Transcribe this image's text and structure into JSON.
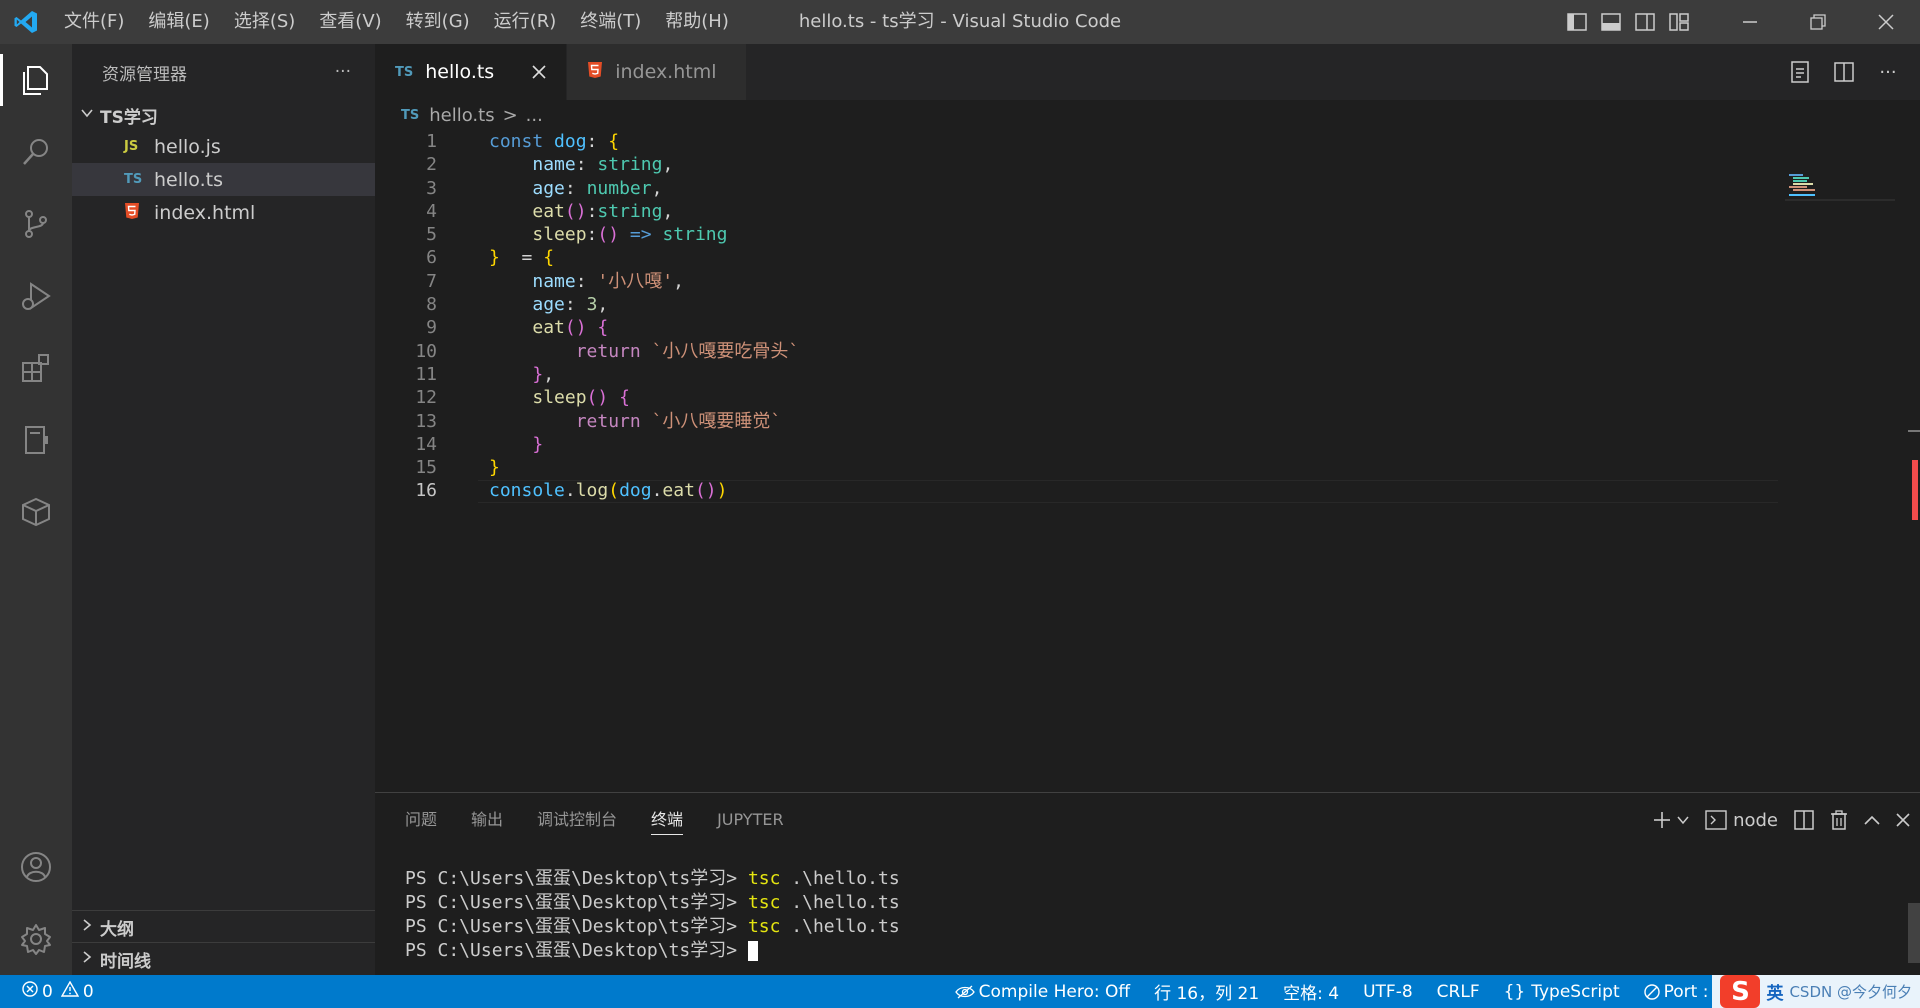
{
  "titlebar": {
    "menu": [
      "文件(F)",
      "编辑(E)",
      "选择(S)",
      "查看(V)",
      "转到(G)",
      "运行(R)",
      "终端(T)",
      "帮助(H)"
    ],
    "window_title": "hello.ts - ts学习 - Visual Studio Code"
  },
  "sidebar": {
    "header": "资源管理器",
    "more": "···",
    "folder": "TS学习",
    "files": [
      {
        "icon": "JS",
        "name": "hello.js",
        "icon_color": "#cbcb41"
      },
      {
        "icon": "TS",
        "name": "hello.ts",
        "icon_color": "#519aba",
        "selected": true
      },
      {
        "icon": "5",
        "name": "index.html",
        "icon_color": "#e44d26"
      }
    ],
    "outline": "大纲",
    "timeline": "时间线"
  },
  "editor": {
    "tabs": [
      {
        "icon": "TS",
        "label": "hello.ts",
        "active": true
      },
      {
        "icon": "5",
        "label": "index.html",
        "active": false
      }
    ],
    "breadcrumb": {
      "icon": "TS",
      "file": "hello.ts",
      "sep": ">",
      "rest": "..."
    },
    "line_numbers": [
      "1",
      "2",
      "3",
      "4",
      "5",
      "6",
      "7",
      "8",
      "9",
      "10",
      "11",
      "12",
      "13",
      "14",
      "15",
      "16"
    ],
    "current_line": 16
  },
  "panel": {
    "tabs": [
      "问题",
      "输出",
      "调试控制台",
      "终端",
      "JUPYTER"
    ],
    "active_tab": "终端",
    "terminal_name": "node",
    "prompt": "PS C:\\Users\\蛋蛋\\Desktop\\ts学习> ",
    "commands": [
      {
        "cmd": "tsc",
        "arg": " .\\hello.ts"
      },
      {
        "cmd": "tsc",
        "arg": " .\\hello.ts"
      },
      {
        "cmd": "tsc",
        "arg": " .\\hello.ts"
      }
    ]
  },
  "statusbar": {
    "errors": "0",
    "warnings": "0",
    "compile_hero": "Compile Hero: Off",
    "position": "行 16，列 21",
    "spaces": "空格: 4",
    "encoding": "UTF-8",
    "eol": "CRLF",
    "language": "TypeScript",
    "port": "Port :",
    "ime": "英",
    "watermark": "CSDN @今夕何夕"
  },
  "colors": {
    "accent": "#007acc",
    "ts_icon": "#519aba",
    "js_icon": "#cbcb41",
    "html_icon": "#e44d26"
  }
}
